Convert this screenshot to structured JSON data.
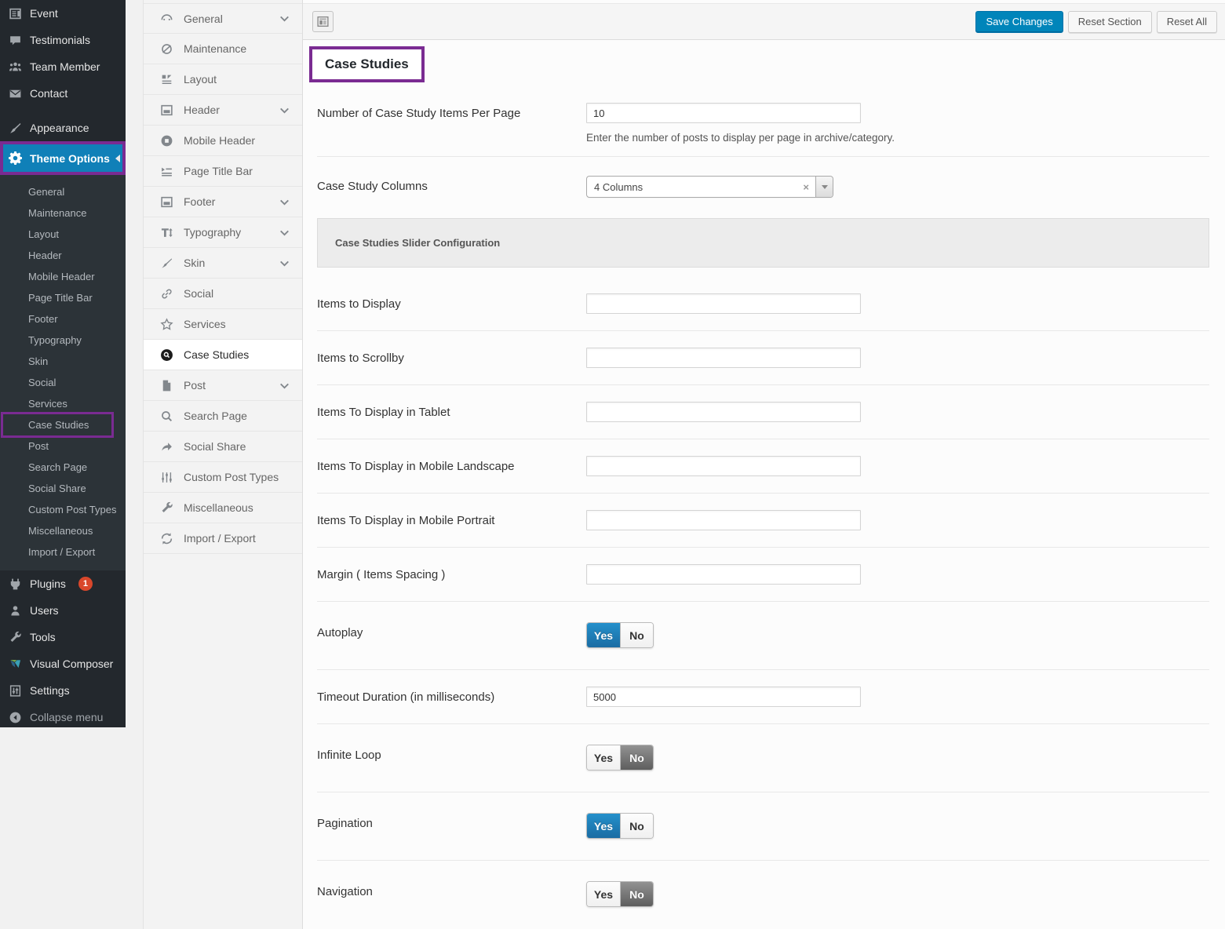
{
  "admin_sidebar": {
    "top_items": [
      {
        "label": "Event",
        "icon": "event-icon"
      },
      {
        "label": "Testimonials",
        "icon": "testimonials-icon"
      },
      {
        "label": "Team Member",
        "icon": "team-member-icon"
      },
      {
        "label": "Contact",
        "icon": "contact-icon"
      }
    ],
    "appearance": {
      "label": "Appearance",
      "icon": "appearance-icon"
    },
    "theme_options": {
      "label": "Theme Options",
      "icon": "gear-icon"
    },
    "submenu": [
      "General",
      "Maintenance",
      "Layout",
      "Header",
      "Mobile Header",
      "Page Title Bar",
      "Footer",
      "Typography",
      "Skin",
      "Social",
      "Services",
      "Case Studies",
      "Post",
      "Search Page",
      "Social Share",
      "Custom Post Types",
      "Miscellaneous",
      "Import / Export"
    ],
    "submenu_highlighted": "Case Studies",
    "bottom_items": [
      {
        "label": "Plugins",
        "icon": "plugin-icon",
        "badge": "1"
      },
      {
        "label": "Users",
        "icon": "users-icon"
      },
      {
        "label": "Tools",
        "icon": "tools-icon"
      },
      {
        "label": "Visual Composer",
        "icon": "visual-composer-icon"
      },
      {
        "label": "Settings",
        "icon": "settings-icon"
      },
      {
        "label": "Collapse menu",
        "icon": "collapse-icon",
        "dim": true
      }
    ]
  },
  "options_menu": {
    "items": [
      {
        "label": "General",
        "icon": "general-icon",
        "expandable": true
      },
      {
        "label": "Maintenance",
        "icon": "maintenance-icon"
      },
      {
        "label": "Layout",
        "icon": "layout-icon"
      },
      {
        "label": "Header",
        "icon": "header-icon",
        "expandable": true
      },
      {
        "label": "Mobile Header",
        "icon": "mobile-header-icon"
      },
      {
        "label": "Page Title Bar",
        "icon": "page-title-bar-icon"
      },
      {
        "label": "Footer",
        "icon": "footer-icon",
        "expandable": true
      },
      {
        "label": "Typography",
        "icon": "typography-icon",
        "expandable": true
      },
      {
        "label": "Skin",
        "icon": "skin-icon",
        "expandable": true
      },
      {
        "label": "Social",
        "icon": "social-icon"
      },
      {
        "label": "Services",
        "icon": "services-icon"
      },
      {
        "label": "Case Studies",
        "icon": "case-studies-icon",
        "active": true
      },
      {
        "label": "Post",
        "icon": "post-icon",
        "expandable": true
      },
      {
        "label": "Search Page",
        "icon": "search-icon"
      },
      {
        "label": "Social Share",
        "icon": "social-share-icon"
      },
      {
        "label": "Custom Post Types",
        "icon": "custom-post-types-icon"
      },
      {
        "label": "Miscellaneous",
        "icon": "miscellaneous-icon"
      },
      {
        "label": "Import / Export",
        "icon": "import-export-icon"
      }
    ]
  },
  "toolbar": {
    "save_label": "Save Changes",
    "reset_section_label": "Reset Section",
    "reset_all_label": "Reset All"
  },
  "page": {
    "title": "Case Studies"
  },
  "form": {
    "rows": [
      {
        "type": "text",
        "label": "Number of Case Study Items Per Page",
        "value": "10",
        "help": "Enter the number of posts to display per page in archive/category.",
        "divider": true
      },
      {
        "type": "select",
        "label": "Case Study Columns",
        "value": "4 Columns",
        "divider": false
      },
      {
        "type": "section",
        "label": "Case Studies Slider Configuration"
      },
      {
        "type": "text",
        "label": "Items to Display",
        "value": "",
        "divider": true
      },
      {
        "type": "text",
        "label": "Items to Scrollby",
        "value": "",
        "divider": true
      },
      {
        "type": "text",
        "label": "Items To Display in Tablet",
        "value": "",
        "divider": true
      },
      {
        "type": "text",
        "label": "Items To Display in Mobile Landscape",
        "value": "",
        "divider": true
      },
      {
        "type": "text",
        "label": "Items To Display in Mobile Portrait",
        "value": "",
        "divider": true
      },
      {
        "type": "text",
        "label": "Margin ( Items Spacing )",
        "value": "",
        "divider": true
      },
      {
        "type": "toggle",
        "label": "Autoplay",
        "options": [
          "Yes",
          "No"
        ],
        "value": "Yes",
        "divider": true
      },
      {
        "type": "text",
        "label": "Timeout Duration (in milliseconds)",
        "value": "5000",
        "divider": true
      },
      {
        "type": "toggle",
        "label": "Infinite Loop",
        "options": [
          "Yes",
          "No"
        ],
        "value": "No",
        "divider": true
      },
      {
        "type": "toggle",
        "label": "Pagination",
        "options": [
          "Yes",
          "No"
        ],
        "value": "Yes",
        "divider": true
      },
      {
        "type": "toggle",
        "label": "Navigation",
        "options": [
          "Yes",
          "No"
        ],
        "value": "No",
        "divider": false
      }
    ]
  },
  "colors": {
    "accent_blue": "#1080b8",
    "button_blue": "#0085ba",
    "highlight_purple": "#7a2b92",
    "toggle_blue": "#1f7fb7",
    "toggle_gray": "#6e6e6e",
    "badge_red": "#d9472b"
  }
}
